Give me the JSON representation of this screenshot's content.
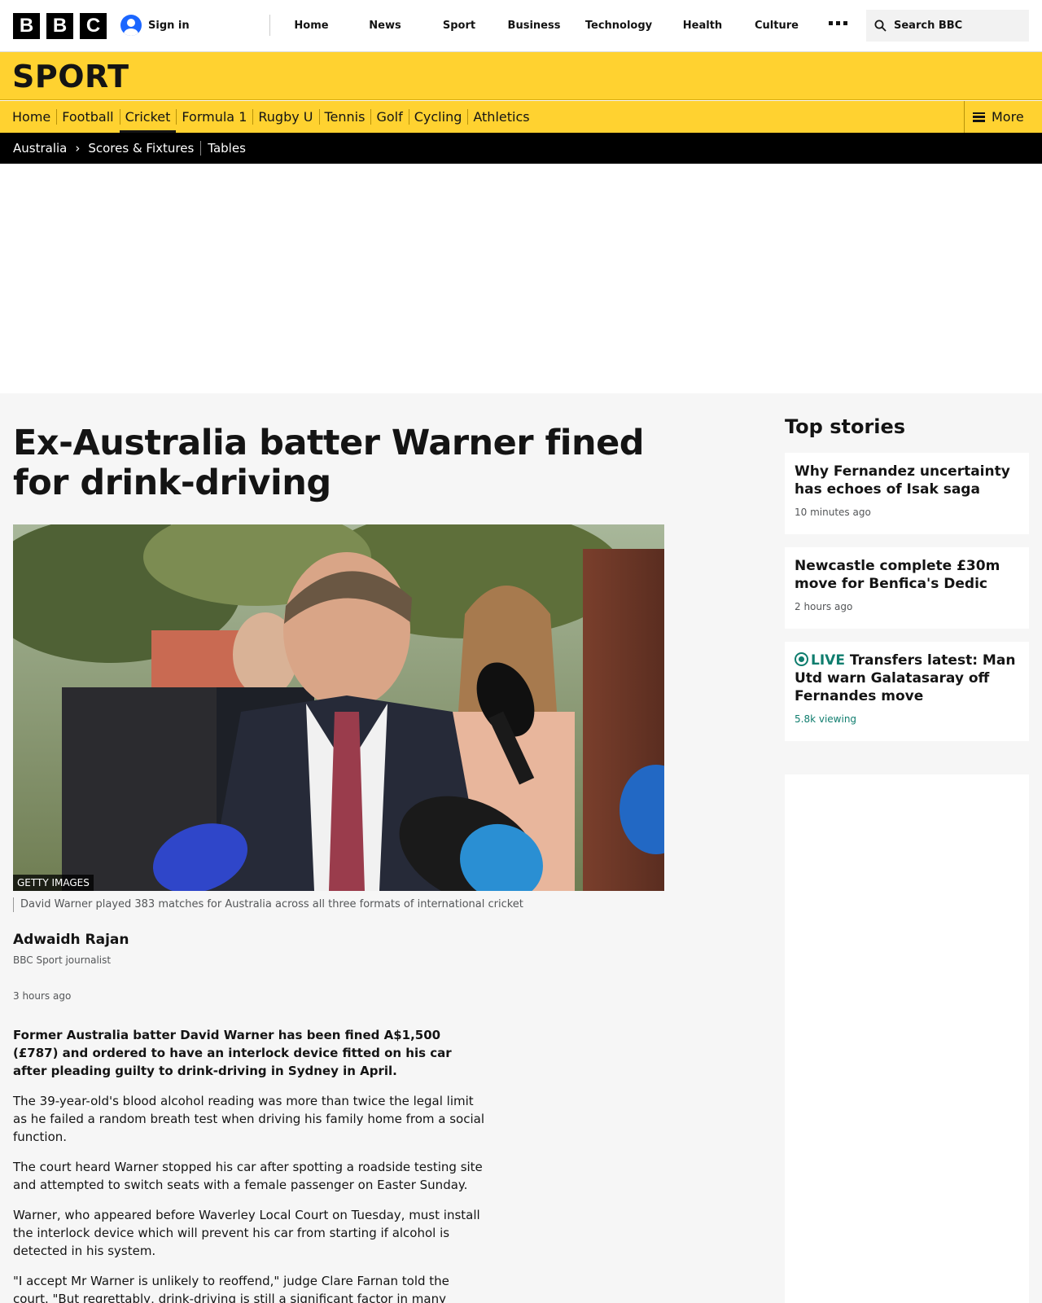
{
  "masthead": {
    "logo_letters": [
      "B",
      "B",
      "C"
    ],
    "signin_label": "Sign in",
    "nav": [
      "Home",
      "News",
      "Sport",
      "Business",
      "Technology",
      "Health",
      "Culture"
    ],
    "search_placeholder": "Search BBC"
  },
  "sport": {
    "title": "SPORT",
    "nav": [
      "Home",
      "Football",
      "Cricket",
      "Formula 1",
      "Rugby U",
      "Tennis",
      "Golf",
      "Cycling",
      "Athletics"
    ],
    "active_nav": "Cricket",
    "more_label": "More"
  },
  "subnav": {
    "section": "Australia",
    "links": [
      "Scores & Fixtures",
      "Tables"
    ]
  },
  "article": {
    "headline": "Ex-Australia batter Warner fined for drink-driving",
    "image_credit": "GETTY IMAGES",
    "caption": "David Warner played 383 matches for Australia across all three formats of international cricket",
    "author": "Adwaidh Rajan",
    "author_role": "BBC Sport journalist",
    "timestamp": "3 hours ago",
    "lead": "Former Australia batter David Warner has been fined A$1,500 (£787) and ordered to have an interlock device fitted on his car after pleading guilty to drink-driving in Sydney in April.",
    "paragraphs": [
      "The 39-year-old's blood alcohol reading was more than twice the legal limit as he failed a random breath test when driving his family home from a social function.",
      "The court heard Warner stopped his car after spotting a roadside testing site and attempted to switch seats with a female passenger on Easter Sunday.",
      "Warner, who appeared before Waverley Local Court on Tuesday, must install the interlock device which will prevent his car from starting if alcohol is detected in his system.",
      "\"I accept Mr Warner is unlikely to reoffend,\" judge Clare Farnan told the court. \"But regrettably, drink-driving is still a significant factor in many crashes in"
    ]
  },
  "sidebar": {
    "title": "Top stories",
    "stories": [
      {
        "title": "Why Fernandez uncertainty has echoes of Isak saga",
        "meta": "10 minutes ago"
      },
      {
        "title": "Newcastle complete £30m move for Benfica's Dedic",
        "meta": "2 hours ago"
      },
      {
        "live_label": "LIVE",
        "title": "Transfers latest: Man Utd warn Galatasaray off Fernandes move",
        "meta": "5.8k viewing"
      }
    ]
  },
  "colors": {
    "sport_yellow": "#ffd230",
    "live_green": "#0f7d6e",
    "signin_blue": "#1b66ff"
  }
}
